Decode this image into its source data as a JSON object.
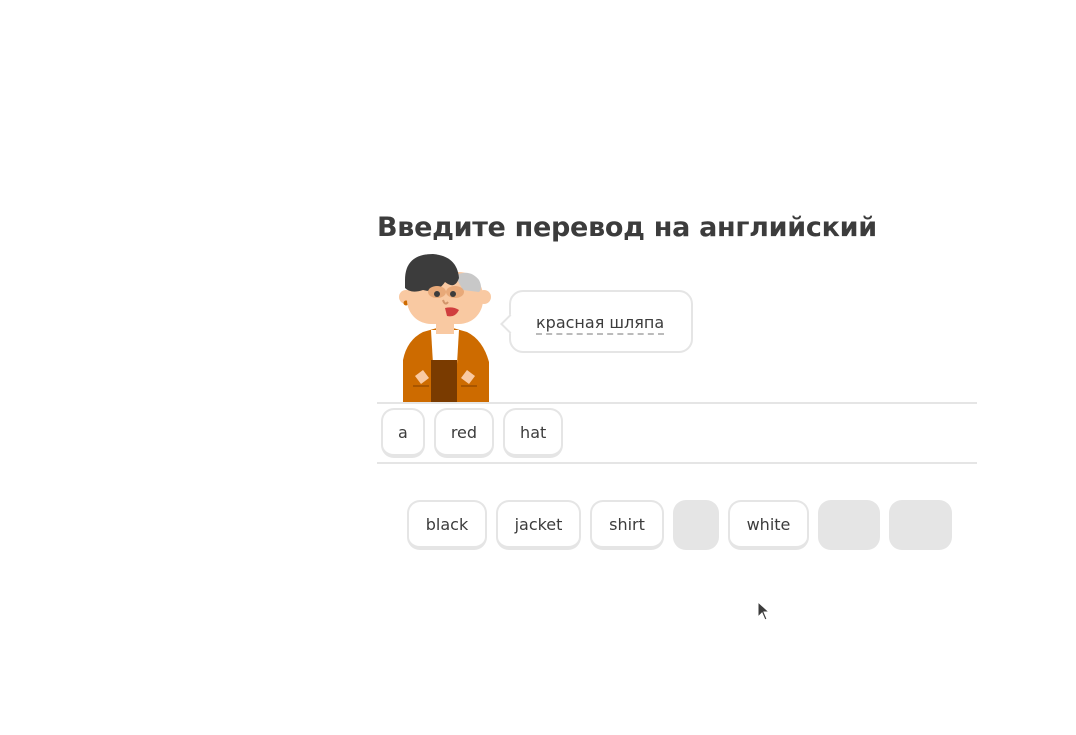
{
  "exercise": {
    "title": "Введите перевод на английский",
    "prompt_phrase": "красная шляпа"
  },
  "answer_tiles": [
    {
      "label": "a"
    },
    {
      "label": "red"
    },
    {
      "label": "hat"
    }
  ],
  "word_bank": [
    {
      "label": "black"
    },
    {
      "label": "jacket"
    },
    {
      "label": "shirt"
    },
    {
      "label": ""
    },
    {
      "label": "white"
    },
    {
      "label": ""
    },
    {
      "label": ""
    }
  ],
  "colors": {
    "border": "#e5e5e5",
    "text": "#3c3c3c",
    "jacket": "#cd6b00",
    "hair": "#3c3c3c",
    "skin": "#f9c9a2"
  },
  "icons": {
    "character": "lily-character-illustration",
    "pointer": "mouse-pointer-icon"
  }
}
